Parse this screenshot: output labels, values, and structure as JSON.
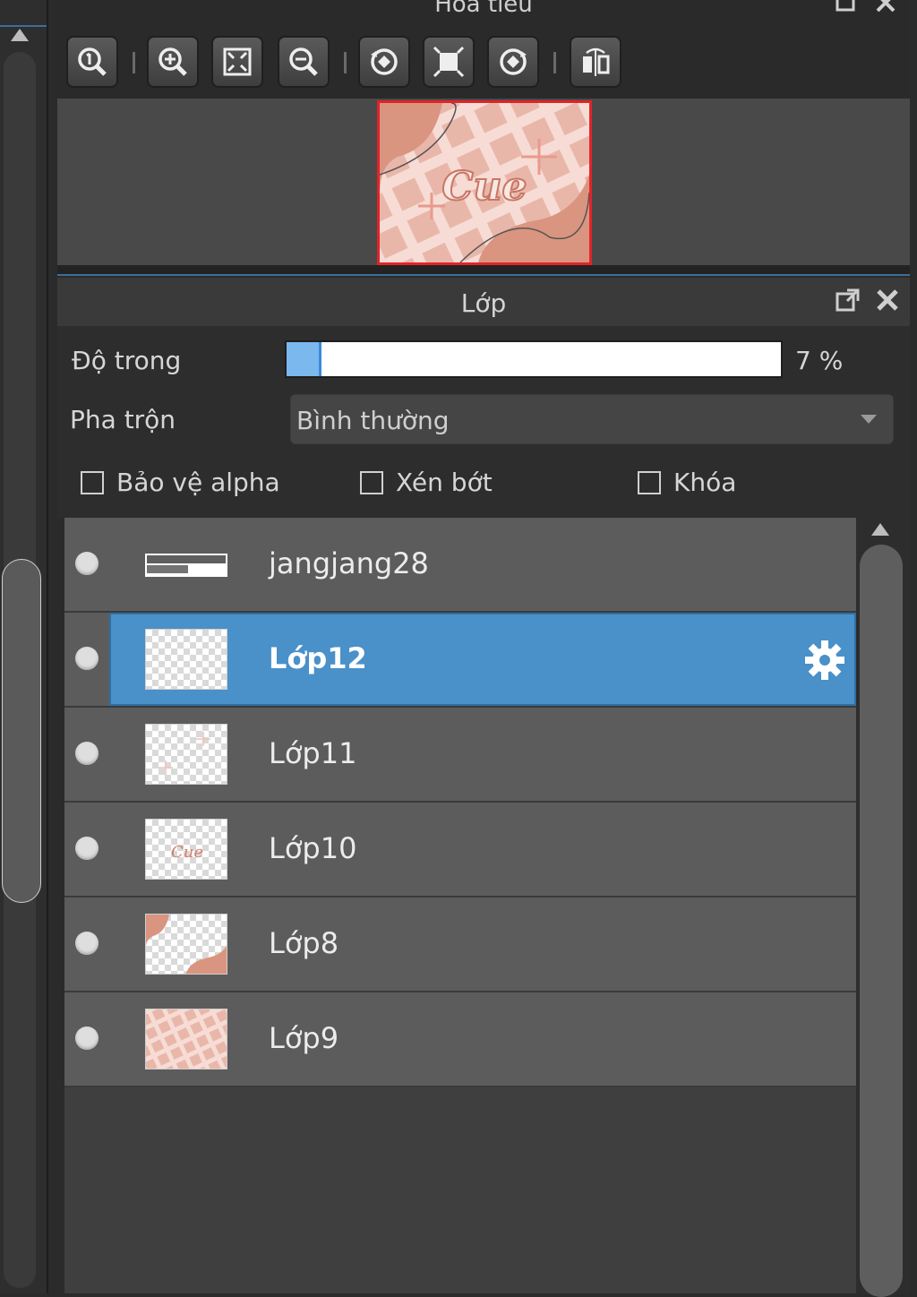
{
  "navigator": {
    "title": "Hoa tiêu",
    "toolbar": [
      {
        "icon": "zoom-actual-icon"
      },
      {
        "icon": "zoom-in-icon"
      },
      {
        "icon": "fit-window-icon"
      },
      {
        "icon": "zoom-out-icon"
      },
      {
        "icon": "rotate-left-icon"
      },
      {
        "icon": "reset-view-icon"
      },
      {
        "icon": "rotate-right-icon"
      },
      {
        "icon": "flip-horizontal-icon"
      }
    ],
    "preview_text": "Cue"
  },
  "layers": {
    "title": "Lớp",
    "opacity_label": "Độ trong",
    "opacity_value": "7 %",
    "opacity_fraction": 0.07,
    "blend_label": "Pha trộn",
    "blend_value": "Bình thường",
    "checkboxes": [
      {
        "label": "Bảo vệ alpha",
        "checked": false
      },
      {
        "label": "Xén bớt",
        "checked": false
      },
      {
        "label": "Khóa",
        "checked": false
      }
    ],
    "items": [
      {
        "name": "jangjang28",
        "selected": false,
        "thumb": "text"
      },
      {
        "name": "Lớp12",
        "selected": true,
        "thumb": "empty"
      },
      {
        "name": "Lớp11",
        "selected": false,
        "thumb": "faint"
      },
      {
        "name": "Lớp10",
        "selected": false,
        "thumb": "cue"
      },
      {
        "name": "Lớp8",
        "selected": false,
        "thumb": "shapes"
      },
      {
        "name": "Lớp9",
        "selected": false,
        "thumb": "pattern"
      }
    ]
  },
  "colors": {
    "selection": "#4a90c9",
    "accent": "#e0242a"
  }
}
